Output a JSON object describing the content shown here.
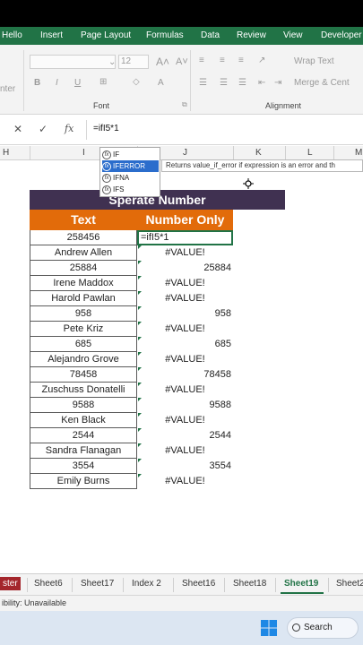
{
  "ribbon_tabs": [
    "Hello",
    "Insert",
    "Page Layout",
    "Formulas",
    "Data",
    "Review",
    "View",
    "Developer"
  ],
  "ribbon": {
    "font_size": "12",
    "wrap_text": "Wrap Text",
    "merge_center": "Merge & Cent",
    "center_partial": "nter",
    "font_group": "Font",
    "alignment_group": "Alignment"
  },
  "formula_bar": {
    "formula": "=ifI5*1",
    "cancel_icon": "✕",
    "enter_icon": "✓",
    "fx_label": "fx"
  },
  "columns": [
    "H",
    "I",
    "J",
    "K",
    "L",
    "M"
  ],
  "autocomplete": {
    "items": [
      "IF",
      "IFERROR",
      "IFNA",
      "IFS"
    ],
    "selected": "IFERROR",
    "tooltip": "Returns value_if_error if expression is an error and th"
  },
  "sheet": {
    "title": "Sperate Number",
    "header_text": "Text",
    "header_number": "Number Only",
    "rows": [
      {
        "text": "258456",
        "value": "=ifI5*1",
        "kind": "edit"
      },
      {
        "text": "Andrew Allen",
        "value": "#VALUE!",
        "kind": "err"
      },
      {
        "text": "25884",
        "value": "25884",
        "kind": "num"
      },
      {
        "text": "Irene Maddox",
        "value": "#VALUE!",
        "kind": "err"
      },
      {
        "text": "Harold Pawlan",
        "value": "#VALUE!",
        "kind": "err"
      },
      {
        "text": "958",
        "value": "958",
        "kind": "num"
      },
      {
        "text": "Pete Kriz",
        "value": "#VALUE!",
        "kind": "err"
      },
      {
        "text": "685",
        "value": "685",
        "kind": "num"
      },
      {
        "text": "Alejandro Grove",
        "value": "#VALUE!",
        "kind": "err"
      },
      {
        "text": "78458",
        "value": "78458",
        "kind": "num"
      },
      {
        "text": "Zuschuss Donatelli",
        "value": "#VALUE!",
        "kind": "err"
      },
      {
        "text": "9588",
        "value": "9588",
        "kind": "num"
      },
      {
        "text": "Ken Black",
        "value": "#VALUE!",
        "kind": "err"
      },
      {
        "text": "2544",
        "value": "2544",
        "kind": "num"
      },
      {
        "text": "Sandra Flanagan",
        "value": "#VALUE!",
        "kind": "err"
      },
      {
        "text": "3554",
        "value": "3554",
        "kind": "num"
      },
      {
        "text": "Emily Burns",
        "value": "#VALUE!",
        "kind": "err"
      }
    ]
  },
  "sheet_tabs": [
    "ster",
    "Sheet6",
    "Sheet17",
    "Index 2",
    "Sheet16",
    "Sheet18",
    "Sheet19",
    "Sheet2"
  ],
  "active_sheet": "Sheet19",
  "status_text": "ibility: Unavailable",
  "taskbar": {
    "search_label": "Search"
  },
  "colors": {
    "excel_green": "#217346",
    "title_bg": "#403151",
    "header_bg": "#e26b0a",
    "selected_item": "#2b6dcc"
  }
}
